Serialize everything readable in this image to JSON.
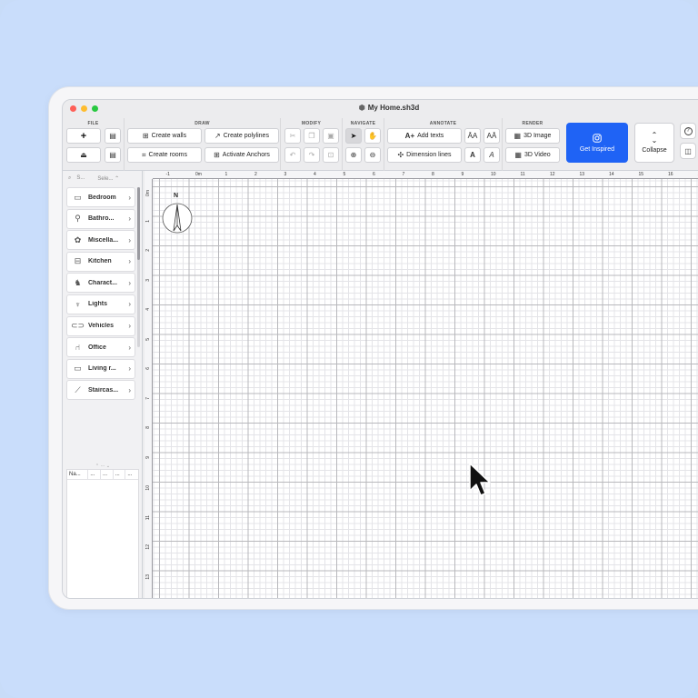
{
  "window": {
    "title": "My Home.sh3d"
  },
  "toolbar": {
    "groups": {
      "file": "FILE",
      "draw": "DRAW",
      "modify": "MODIFY",
      "navigate": "NAVIGATE",
      "annotate": "ANNOTATE",
      "render": "RENDER"
    },
    "draw": {
      "create_walls": "Create walls",
      "create_polylines": "Create polylines",
      "create_rooms": "Create rooms",
      "activate_anchors": "Activate Anchors"
    },
    "annotate": {
      "add_texts": "Add texts",
      "dimension_lines": "Dimension lines"
    },
    "render": {
      "image_3d": "3D Image",
      "video_3d": "3D Video"
    },
    "get_inspired": "Get Inspired",
    "collapse": "Collapse"
  },
  "sidebar": {
    "search_placeholder": "S...",
    "select_label": "Sele...",
    "categories": [
      {
        "label": "Bedroom",
        "icon": "bed-icon"
      },
      {
        "label": "Bathro...",
        "icon": "shower-icon"
      },
      {
        "label": "Miscella...",
        "icon": "plant-icon"
      },
      {
        "label": "Kitchen",
        "icon": "stove-icon"
      },
      {
        "label": "Charact...",
        "icon": "dog-icon"
      },
      {
        "label": "Lights",
        "icon": "lamp-icon"
      },
      {
        "label": "Vehicles",
        "icon": "car-icon"
      },
      {
        "label": "Office",
        "icon": "office-chair-icon"
      },
      {
        "label": "Living r...",
        "icon": "sofa-icon"
      },
      {
        "label": "Staircas...",
        "icon": "stairs-icon"
      }
    ],
    "table_columns": [
      "Na...",
      "...",
      "...",
      "...",
      "..."
    ]
  },
  "plan": {
    "ruler_top": [
      "-2",
      "-1",
      "0m",
      "1",
      "2",
      "3",
      "4",
      "5",
      "6",
      "7",
      "8",
      "9",
      "10",
      "11",
      "12",
      "13",
      "14",
      "15",
      "16",
      "17",
      "18"
    ],
    "ruler_left": [
      "0m",
      "1",
      "2",
      "3",
      "4",
      "5",
      "6",
      "7",
      "8",
      "9",
      "10",
      "11",
      "12",
      "13",
      "14"
    ],
    "compass_letter": "N"
  }
}
